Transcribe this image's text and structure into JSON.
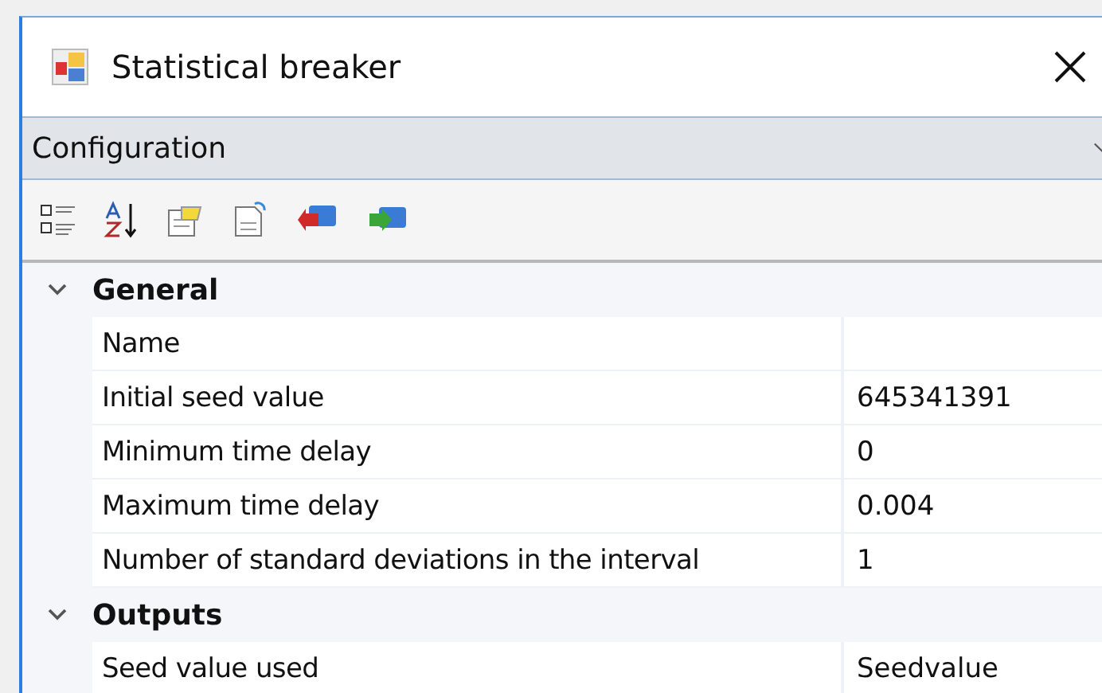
{
  "window": {
    "title": "Statistical breaker"
  },
  "object_selector": {
    "value": "Configuration"
  },
  "categories": [
    {
      "name": "General",
      "expanded": true,
      "properties": [
        {
          "name": "Name"
        },
        {
          "name": "Initial seed value",
          "value": "645341391"
        },
        {
          "name": "Minimum time delay",
          "value": "0"
        },
        {
          "name": "Maximum time delay",
          "value": "0.004"
        },
        {
          "name": "Number of standard deviations in the interval",
          "value": "1"
        }
      ]
    },
    {
      "name": "Outputs",
      "expanded": true,
      "properties": [
        {
          "name": "Seed value used",
          "value": "Seedvalue"
        }
      ]
    }
  ]
}
